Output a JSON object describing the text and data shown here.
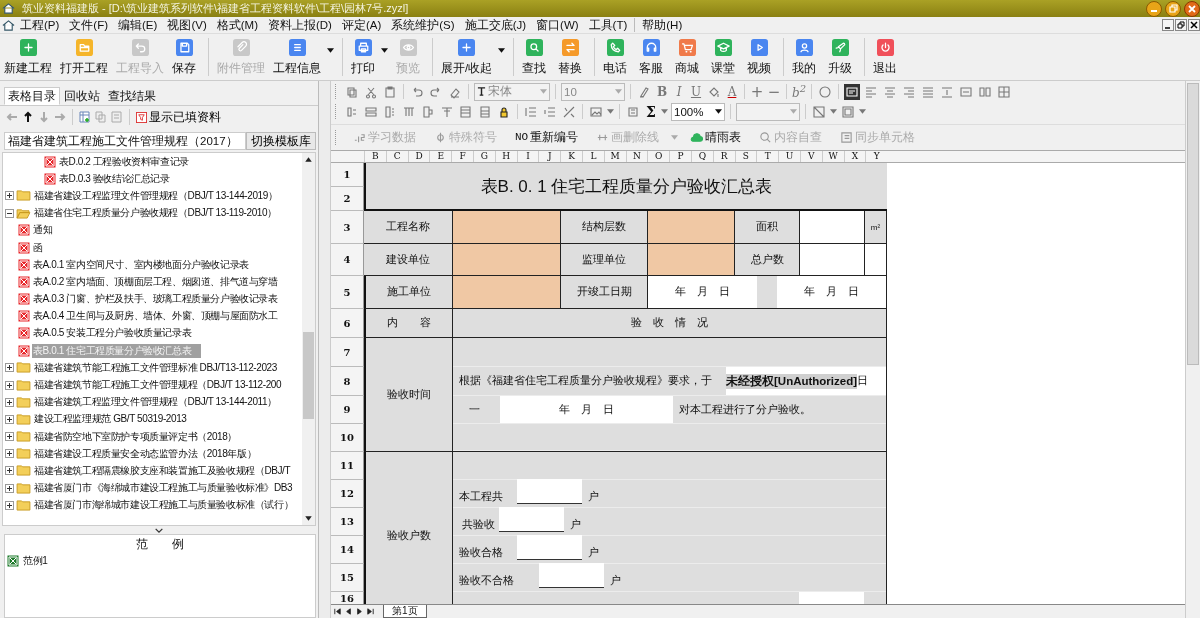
{
  "window": {
    "title": "筑业资料福建版 - [D:\\筑业建筑系列软件\\福建省工程资料软件\\工程\\园林7号.zyzl]"
  },
  "menu": [
    "工程(P)",
    "文件(F)",
    "编辑(E)",
    "视图(V)",
    "格式(M)",
    "资料上报(D)",
    "评定(A)",
    "系统维护(S)",
    "施工交底(J)",
    "窗口(W)",
    "工具(T)",
    "帮助(H)"
  ],
  "toolbar": [
    [
      {
        "label": "新建工程",
        "color": "#2fb35c",
        "disabled": false,
        "dropdown": false
      },
      {
        "label": "打开工程",
        "color": "#f5b52a",
        "disabled": false,
        "dropdown": false
      },
      {
        "label": "工程导入",
        "color": "#c8c8c8",
        "disabled": true,
        "dropdown": false
      },
      {
        "label": "保存",
        "color": "#4a86f0",
        "disabled": false,
        "dropdown": false
      }
    ],
    [
      {
        "label": "附件管理",
        "color": "#c8c8c8",
        "disabled": true,
        "dropdown": false
      },
      {
        "label": "工程信息",
        "color": "#4a86f0",
        "disabled": false,
        "dropdown": true
      }
    ],
    [
      {
        "label": "打印",
        "color": "#4a86f0",
        "disabled": false,
        "dropdown": true
      },
      {
        "label": "预览",
        "color": "#c8c8c8",
        "disabled": true,
        "dropdown": false
      }
    ],
    [
      {
        "label": "展开/收起",
        "color": "#4a86f0",
        "disabled": false,
        "dropdown": true
      }
    ],
    [
      {
        "label": "查找",
        "color": "#2fb35c",
        "disabled": false,
        "dropdown": false
      },
      {
        "label": "替换",
        "color": "#f59a2a",
        "disabled": false,
        "dropdown": false
      }
    ],
    [
      {
        "label": "电话",
        "color": "#2fb35c",
        "disabled": false,
        "dropdown": false
      },
      {
        "label": "客服",
        "color": "#4a86f0",
        "disabled": false,
        "dropdown": false
      },
      {
        "label": "商城",
        "color": "#f07a4a",
        "disabled": false,
        "dropdown": false
      },
      {
        "label": "课堂",
        "color": "#2fb35c",
        "disabled": false,
        "dropdown": false
      },
      {
        "label": "视频",
        "color": "#4a86f0",
        "disabled": false,
        "dropdown": false
      }
    ],
    [
      {
        "label": "我的",
        "color": "#4a86f0",
        "disabled": false,
        "dropdown": false
      },
      {
        "label": "升级",
        "color": "#2fb35c",
        "disabled": false,
        "dropdown": false
      }
    ],
    [
      {
        "label": "退出",
        "color": "#f0505a",
        "disabled": false,
        "dropdown": false
      }
    ]
  ],
  "format_toolbar": {
    "font": "宋体",
    "size": "10",
    "zoom": "100%",
    "glyphs": [
      "B",
      "I",
      "U",
      "A",
      "+",
      "−",
      "b$^{2}$",
      "Σ"
    ]
  },
  "action_bar": [
    {
      "label": "学习数据",
      "disabled": true
    },
    {
      "label": "特殊符号",
      "disabled": true
    },
    {
      "label": "重新编号",
      "prefix": "NO",
      "disabled": false
    },
    {
      "label": "画删除线",
      "disabled": true
    },
    {
      "label": "晴雨表",
      "disabled": false
    },
    {
      "label": "内容自查",
      "disabled": true
    },
    {
      "label": "同步单元格",
      "disabled": true
    }
  ],
  "left_panel": {
    "tabs": [
      {
        "label": "表格目录",
        "selected": true
      },
      {
        "label": "回收站",
        "selected": false
      },
      {
        "label": "查找结果",
        "selected": false
      }
    ],
    "nav": [
      {
        "disabled": true
      },
      {
        "disabled": false
      },
      {
        "disabled": true
      },
      {
        "disabled": true
      }
    ],
    "filter_button": "显示已填资料",
    "library": "福建省建筑工程施工文件管理规程（2017）",
    "switch_button": "切换模板库",
    "tree": [
      {
        "children": [
          {
            "children": [
              {
                "children": [
                  {
                    "label": "表D.0.2 工程验收资料审查记录",
                    "kind": "sheet",
                    "selected": false
                  },
                  {
                    "label": "表D.0.3 验收结论汇总记录",
                    "kind": "sheet",
                    "selected": false
                  }
                ]
              }
            ]
          }
        ]
      },
      {
        "label": "福建省建设工程监理文件管理规程（DBJ/T 13-144-2019）",
        "kind": "folder",
        "expanded": false,
        "selected": false
      },
      {
        "label": "福建省住宅工程质量分户验收规程（DBJ/T 13-119-2010）",
        "kind": "folder",
        "expanded": true,
        "selected": false,
        "children": [
          {
            "label": "通知",
            "kind": "sheet",
            "selected": false
          },
          {
            "label": "函",
            "kind": "sheet",
            "selected": false
          },
          {
            "label": "表A.0.1 室内空间尺寸、室内楼地面分户验收记录表",
            "kind": "sheet",
            "selected": false
          },
          {
            "label": "表A.0.2 室内墙面、顶棚面层工程、烟囱道、排气道与穿墙",
            "kind": "sheet",
            "selected": false
          },
          {
            "label": "表A.0.3 门窗、护栏及扶手、玻璃工程质量分户验收记录表",
            "kind": "sheet",
            "selected": false
          },
          {
            "label": "表A.0.4 卫生间与及厨房、墙体、外窗、顶棚与屋面防水工",
            "kind": "sheet",
            "selected": false
          },
          {
            "label": "表A.0.5 安装工程分户验收质量记录表",
            "kind": "sheet",
            "selected": false
          },
          {
            "label": "表B.0.1 住宅工程质量分户验收汇总表",
            "kind": "sheet",
            "selected": true
          }
        ]
      },
      {
        "label": "福建省建筑节能工程施工文件管理标准 DBJ/T13-112-2023",
        "kind": "folder",
        "expanded": false,
        "selected": false
      },
      {
        "label": "福建省建筑节能工程施工文件管理规程（DBJ/T 13-112-200",
        "kind": "folder",
        "expanded": false,
        "selected": false
      },
      {
        "label": "福建省建筑工程监理文件管理规程（DBJ/T 13-144-2011）",
        "kind": "folder",
        "expanded": false,
        "selected": false
      },
      {
        "label": "建设工程监理规范 GB/T 50319-2013",
        "kind": "folder",
        "expanded": false,
        "selected": false
      },
      {
        "label": "福建省防空地下室防护专项质量评定书（2018）",
        "kind": "folder",
        "expanded": false,
        "selected": false
      },
      {
        "label": "福建省建设工程质量安全动态监管办法（2018年版）",
        "kind": "folder",
        "expanded": false,
        "selected": false
      },
      {
        "label": "福建省建筑工程隔震橡胶支座和装置施工及验收规程（DBJ/T",
        "kind": "folder",
        "expanded": false,
        "selected": false
      },
      {
        "label": "福建省厦门市《海绵城市建设工程施工与质量验收标准》DB3",
        "kind": "folder",
        "expanded": false,
        "selected": false
      },
      {
        "label": "福建省厦门市海绵城市建设工程施工与质量验收标准（试行）",
        "kind": "folder",
        "expanded": false,
        "selected": false
      }
    ],
    "sample": {
      "title": "范　　例",
      "items": [
        "范例1"
      ]
    }
  },
  "sheet": {
    "columns": [
      "B",
      "C",
      "D",
      "E",
      "F",
      "G",
      "H",
      "I",
      "J",
      "K",
      "L",
      "M",
      "N",
      "O",
      "P",
      "Q",
      "R",
      "S",
      "T",
      "U",
      "V",
      "W",
      "X",
      "Y"
    ],
    "row_numbers": [
      "1",
      "2",
      "3",
      "4",
      "5",
      "6",
      "7",
      "8",
      "9",
      "10",
      "11",
      "12",
      "13",
      "14",
      "15",
      "16"
    ],
    "tab": "第1页",
    "form": {
      "title": "表B. 0. 1  住宅工程质量分户验收汇总表",
      "info_rows": [
        [
          {
            "label": "工程名称",
            "required": true
          },
          {
            "label": "结构层数",
            "required": true
          },
          {
            "label": "面积",
            "required": false,
            "unit": "m²"
          }
        ],
        [
          {
            "label": "建设单位",
            "required": true
          },
          {
            "label": "监理单位",
            "required": true
          },
          {
            "label": "总户数",
            "required": false
          }
        ]
      ],
      "row5": {
        "label": "施工单位",
        "required": true,
        "date_label": "开竣工日期",
        "start_date": "年　月　日",
        "end_date": "年　月　日"
      },
      "content_header": {
        "label": "内　　容",
        "value": "验　收　情　况"
      },
      "acceptance_time": {
        "label": "验收时间",
        "sentence": "根据《福建省住宅工程质量分户验收规程》要求，于",
        "unauthorized": "未经授权[UnAuthorized]",
        "day": "日",
        "dash": "一",
        "date": "年　月　日",
        "tail": "对本工程进行了分户验收。"
      },
      "households": {
        "label": "验收户数",
        "lines": [
          {
            "label": "本工程共",
            "unit": "户"
          },
          {
            "label": "共验收",
            "unit": "户"
          },
          {
            "label": "验收合格",
            "unit": "户"
          },
          {
            "label": "验收不合格",
            "unit": "户"
          }
        ]
      }
    }
  }
}
